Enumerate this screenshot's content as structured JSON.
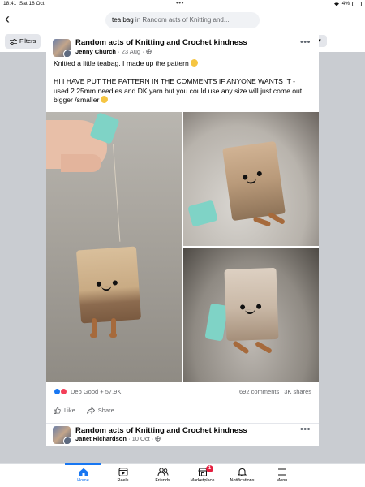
{
  "status_bar": {
    "time": "18:41",
    "date": "Sat 18 Oct",
    "dots": "•••",
    "battery": "4%"
  },
  "header": {
    "search_query": "tea bag",
    "search_context": " in Random acts of Knitting and..."
  },
  "filters": {
    "label": "Filters"
  },
  "post": {
    "group": "Random acts of Knitting and Crochet kindness",
    "author": "Jenny Church",
    "date": "23 Aug",
    "sep": " · ",
    "text1": "Knitted a little teabag. I made up the pattern",
    "text2": "HI I HAVE PUT THE PATTERN IN THE COMMENTS IF ANYONE WANTS IT - I used 2.25mm needles and DK yarn but you could use any size will just come out bigger /smaller",
    "reactions_label": "Deb Good + 57.9K",
    "comments": "692 comments",
    "shares": "3K shares",
    "like_label": "Like",
    "share_label": "Share"
  },
  "post2": {
    "group": "Random acts of Knitting and Crochet kindness",
    "author": "Janet Richardson",
    "date": "10 Oct",
    "sep": " · "
  },
  "tabbar": {
    "tabs": [
      {
        "label": "Home"
      },
      {
        "label": "Reels"
      },
      {
        "label": "Friends"
      },
      {
        "label": "Marketplace",
        "badge": "1"
      },
      {
        "label": "Notifications"
      },
      {
        "label": "Menu"
      }
    ]
  },
  "colors": {
    "accent": "#1877f2",
    "badge": "#e41e3f",
    "teal_tag": "#7fd3c6"
  }
}
